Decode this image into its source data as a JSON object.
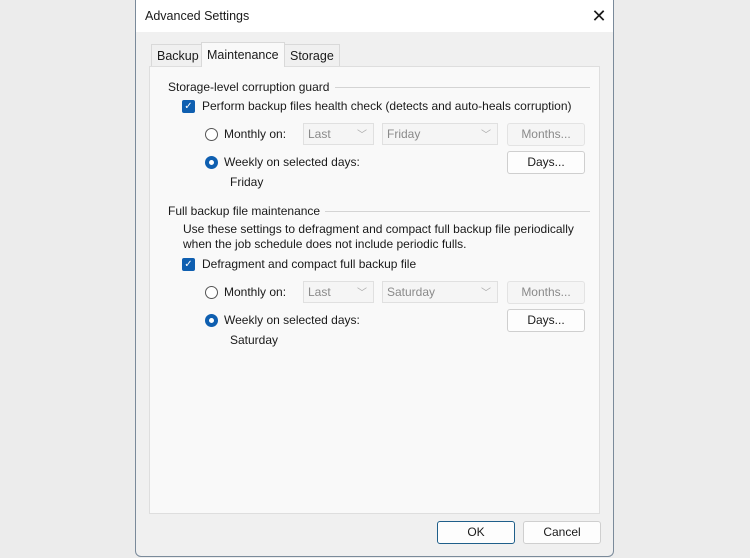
{
  "window": {
    "title": "Advanced Settings"
  },
  "tabs": [
    {
      "label": "Backup"
    },
    {
      "label": "Maintenance"
    },
    {
      "label": "Storage"
    }
  ],
  "corruption_guard": {
    "group_label": "Storage-level corruption guard",
    "checkbox_label": "Perform backup files health check (detects and auto-heals corruption)",
    "checked": true,
    "monthly_label": "Monthly on:",
    "monthly_week": "Last",
    "monthly_day": "Friday",
    "months_button": "Months...",
    "weekly_label": "Weekly on selected days:",
    "days_button": "Days...",
    "selected_days": "Friday"
  },
  "full_maintenance": {
    "group_label": "Full backup file maintenance",
    "description_line1": "Use these settings to defragment and compact full backup file periodically",
    "description_line2": "when the job schedule does not include periodic fulls.",
    "checkbox_label": "Defragment and compact full backup file",
    "checked": true,
    "monthly_label": "Monthly on:",
    "monthly_week": "Last",
    "monthly_day": "Saturday",
    "months_button": "Months...",
    "weekly_label": "Weekly on selected days:",
    "days_button": "Days...",
    "selected_days": "Saturday"
  },
  "footer": {
    "ok": "OK",
    "cancel": "Cancel"
  }
}
